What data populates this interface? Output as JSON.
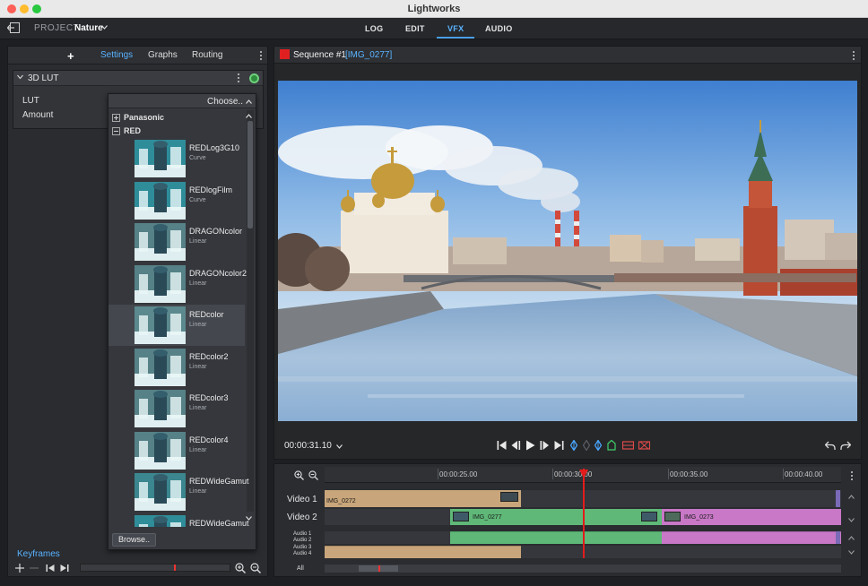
{
  "window": {
    "title": "Lightworks"
  },
  "project": {
    "label": "PROJECT",
    "name": "Nature"
  },
  "nav_tabs": [
    {
      "label": "LOG",
      "active": false
    },
    {
      "label": "EDIT",
      "active": false
    },
    {
      "label": "VFX",
      "active": true
    },
    {
      "label": "AUDIO",
      "active": false
    }
  ],
  "left_panel": {
    "add_label": "+",
    "tabs": [
      {
        "label": "Settings",
        "active": true
      },
      {
        "label": "Graphs",
        "active": false
      },
      {
        "label": "Routing",
        "active": false
      }
    ],
    "effect": {
      "title": "3D LUT",
      "enabled": true,
      "params": [
        {
          "label": "LUT"
        },
        {
          "label": "Amount"
        }
      ]
    },
    "lut_dropdown": {
      "selected": "Choose..",
      "groups": [
        {
          "name": "Panasonic",
          "expanded": false
        },
        {
          "name": "RED",
          "expanded": true
        }
      ],
      "items": [
        {
          "name": "REDLog3G10",
          "type": "Curve",
          "tint": "#2ad6e8"
        },
        {
          "name": "REDlogFilm",
          "type": "Curve",
          "tint": "#2ad6e8"
        },
        {
          "name": "DRAGONcolor",
          "type": "Linear",
          "tint": "#6fbfc4"
        },
        {
          "name": "DRAGONcolor2",
          "type": "Linear",
          "tint": "#6fbfc4"
        },
        {
          "name": "REDcolor",
          "type": "Linear",
          "tint": "#6fbfc4",
          "selected": true
        },
        {
          "name": "REDcolor2",
          "type": "Linear",
          "tint": "#6fbfc4"
        },
        {
          "name": "REDcolor3",
          "type": "Linear",
          "tint": "#6fbfc4"
        },
        {
          "name": "REDcolor4",
          "type": "Linear",
          "tint": "#6fbfc4"
        },
        {
          "name": "REDWideGamut",
          "type": "Linear",
          "tint": "#3fc8d4"
        },
        {
          "name": "REDWideGamut",
          "type": "",
          "tint": "#2ad6e8"
        }
      ],
      "browse_label": "Browse.."
    },
    "keyframes_label": "Keyframes"
  },
  "viewer": {
    "sequence_title": "Sequence #1",
    "clip_tag": "[IMG_0277]",
    "timecode": "00:00:31.10"
  },
  "timeline": {
    "ruler": [
      "00:00:25.00",
      "00:00:30.00",
      "00:00:35.00",
      "00:00:40.00"
    ],
    "tracks": {
      "video1": "Video 1",
      "video2": "Video 2",
      "audio": [
        "Audio 1",
        "Audio 2",
        "Audio 3",
        "Audio 4"
      ],
      "all": "All"
    },
    "clips": {
      "v1_a": "IMG_0272",
      "v2_a": "IMG_0277",
      "v2_b": "IMG_0273"
    },
    "colors": {
      "tan": "#c8a57a",
      "green": "#5fb878",
      "magenta": "#c878c6",
      "playhead": "#e21c1c"
    }
  },
  "accent": "#5ab3ff"
}
